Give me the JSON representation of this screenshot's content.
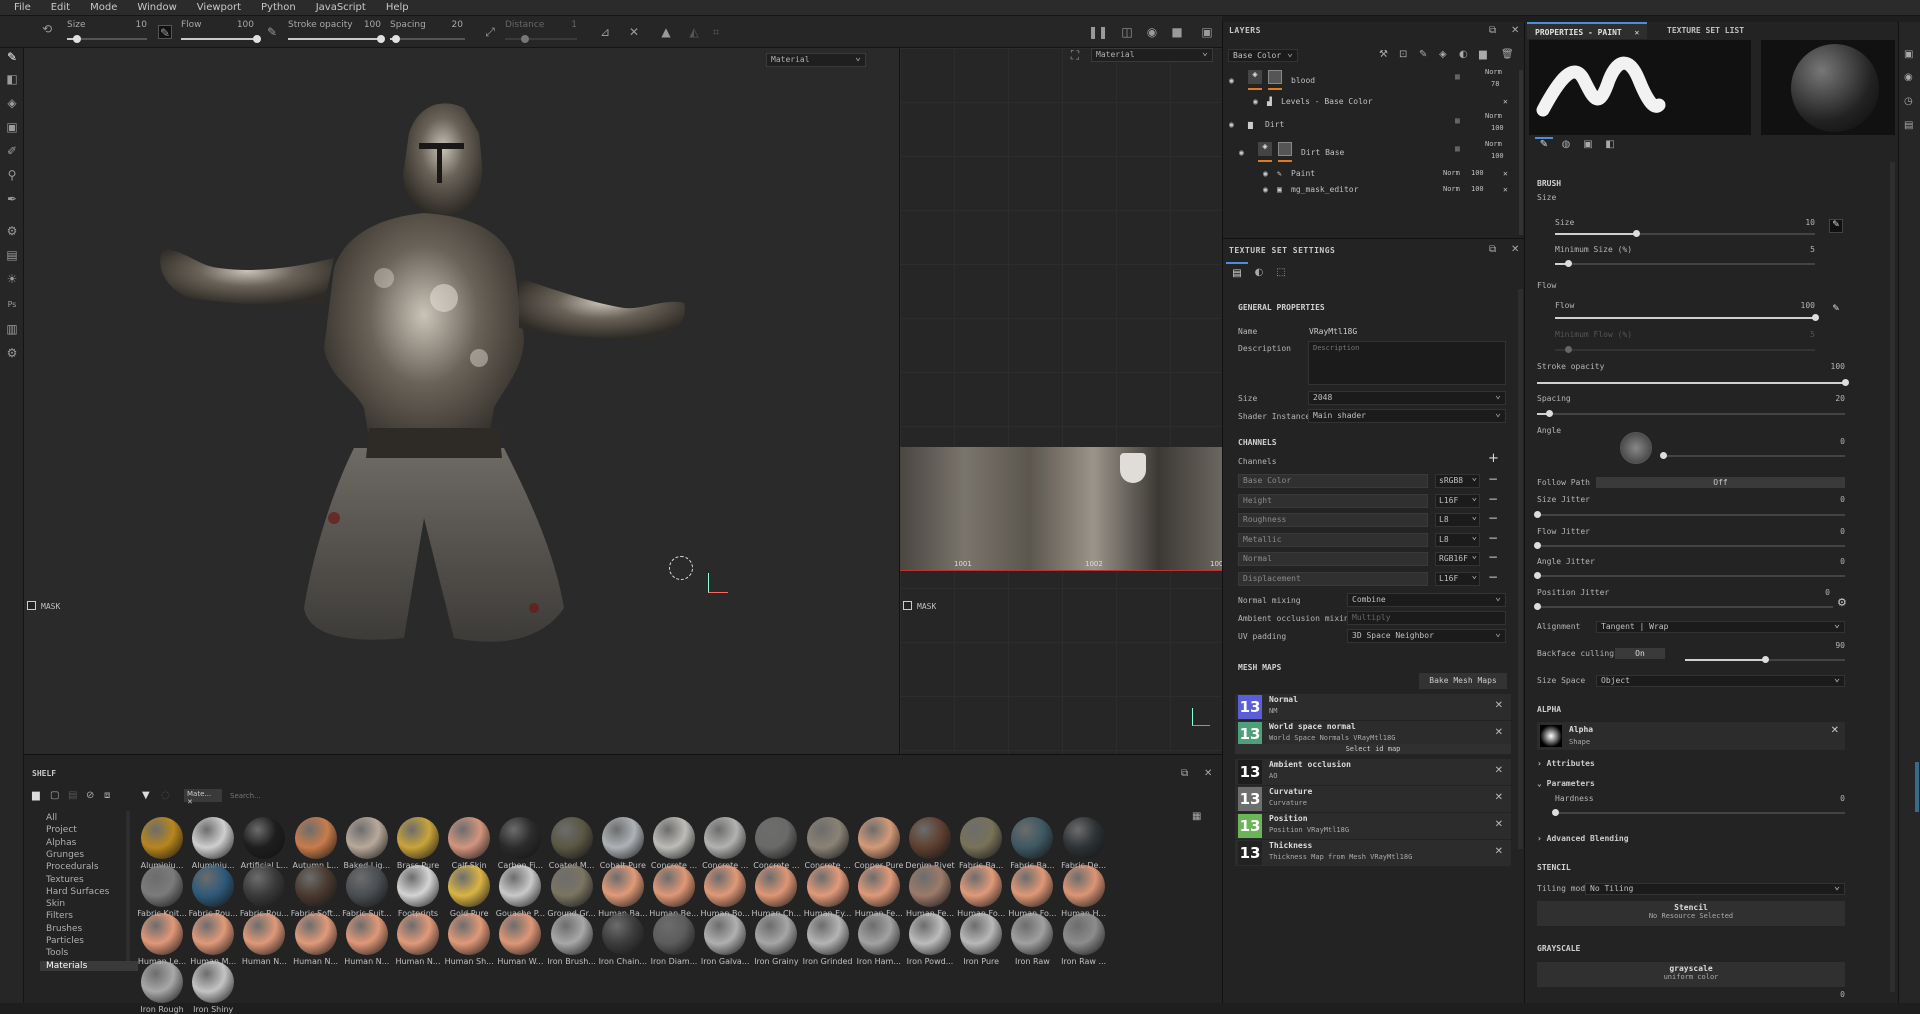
{
  "menu": [
    "File",
    "Edit",
    "Mode",
    "Window",
    "Viewport",
    "Python",
    "JavaScript",
    "Help"
  ],
  "toolbar": {
    "size_label": "Size",
    "size_value": "10",
    "flow_label": "Flow",
    "flow_value": "100",
    "stroke_label": "Stroke opacity",
    "stroke_value": "100",
    "spacing_label": "Spacing",
    "spacing_value": "20",
    "distance_label": "Distance",
    "distance_value": "1"
  },
  "viewport3d": {
    "mode": "Material",
    "mask_label": "MASK"
  },
  "viewport2d": {
    "mode": "Material",
    "mask_label": "MASK",
    "uv_tiles": [
      "1001",
      "1002",
      "100"
    ]
  },
  "layers": {
    "title": "LAYERS",
    "channel": "Base Color",
    "rows": [
      {
        "name": "blood",
        "blend": "Norm",
        "opacity": "78"
      },
      {
        "name": "Levels - Base Color"
      },
      {
        "name": "Dirt",
        "blend": "Norm",
        "opacity": "100"
      },
      {
        "name": "Dirt Base",
        "blend": "Norm",
        "opacity": "100"
      },
      {
        "name": "Paint",
        "blend": "Norm",
        "opacity": "100"
      },
      {
        "name": "mg_mask_editor",
        "blend": "Norm",
        "opacity": "100"
      }
    ]
  },
  "texset": {
    "title": "TEXTURE SET SETTINGS",
    "general": "GENERAL PROPERTIES",
    "name_label": "Name",
    "name_value": "VRayMtl18G",
    "desc_label": "Description",
    "desc_placeholder": "Description",
    "size_label": "Size",
    "size_value": "2048",
    "shader_label": "Shader Instance",
    "shader_value": "Main shader",
    "channels_title": "CHANNELS",
    "channels_label": "Channels",
    "channels": [
      {
        "name": "Base Color",
        "fmt": "sRGB8"
      },
      {
        "name": "Height",
        "fmt": "L16F"
      },
      {
        "name": "Roughness",
        "fmt": "L8"
      },
      {
        "name": "Metallic",
        "fmt": "L8"
      },
      {
        "name": "Normal",
        "fmt": "RGB16F"
      },
      {
        "name": "Displacement",
        "fmt": "L16F"
      }
    ],
    "normal_mixing_label": "Normal mixing",
    "normal_mixing_value": "Combine",
    "ao_mixing_label": "Ambient occlusion mixing",
    "ao_mixing_value": "Multiply",
    "uv_padding_label": "UV padding",
    "uv_padding_value": "3D Space Neighbor",
    "mesh_maps_title": "MESH MAPS",
    "bake_button": "Bake Mesh Maps",
    "select_id": "Select id map",
    "mesh_maps": [
      {
        "title": "Normal",
        "sub": "NM",
        "glyph": "13",
        "color": "#5a5fd8"
      },
      {
        "title": "World space normal",
        "sub": "World Space Normals VRayMtl18G",
        "glyph": "13",
        "color": "#4fa07a"
      },
      {
        "title": "Ambient occlusion",
        "sub": "AO",
        "glyph": "13",
        "color": "#1d1d1d"
      },
      {
        "title": "Curvature",
        "sub": "Curvature",
        "glyph": "13",
        "color": "#6e6e6e"
      },
      {
        "title": "Position",
        "sub": "Position VRayMtl18G",
        "glyph": "13",
        "color": "#6db35a"
      },
      {
        "title": "Thickness",
        "sub": "Thickness Map from Mesh VRayMtl18G",
        "glyph": "13",
        "color": "#222"
      }
    ]
  },
  "props": {
    "tab1": "PROPERTIES - PAINT",
    "tab2": "TEXTURE SET LIST",
    "brush": "BRUSH",
    "size_group": "Size",
    "size_label": "Size",
    "size_value": "10",
    "minsize_label": "Minimum Size (%)",
    "minsize_value": "5",
    "flow_group": "Flow",
    "flow_label": "Flow",
    "flow_value": "100",
    "minflow_label": "Minimum Flow (%)",
    "minflow_value": "5",
    "stroke_label": "Stroke opacity",
    "stroke_value": "100",
    "spacing_label": "Spacing",
    "spacing_value": "20",
    "angle_label": "Angle",
    "angle_value": "0",
    "follow_label": "Follow Path",
    "follow_value": "Off",
    "sizej_label": "Size Jitter",
    "sizej_value": "0",
    "flowj_label": "Flow Jitter",
    "flowj_value": "0",
    "anglej_label": "Angle Jitter",
    "anglej_value": "0",
    "posj_label": "Position Jitter",
    "posj_value": "0",
    "align_label": "Alignment",
    "align_value": "Tangent | Wrap",
    "backface_label": "Backface culling",
    "backface_on": "On",
    "backface_value": "90",
    "sizespace_label": "Size Space",
    "sizespace_value": "Object",
    "alpha_sec": "ALPHA",
    "alpha_name": "Alpha",
    "alpha_sub": "Shape",
    "attributes": "Attributes",
    "parameters": "Parameters",
    "hardness_label": "Hardness",
    "hardness_value": "0",
    "advanced": "Advanced Blending",
    "stencil_sec": "STENCIL",
    "tiling_label": "Tiling mode",
    "tiling_value": "No Tiling",
    "stencil_name": "Stencil",
    "stencil_sub": "No Resource Selected",
    "grayscale_sec": "GRAYSCALE",
    "gray_name": "grayscale",
    "gray_sub": "uniform color",
    "gray_value": "0"
  },
  "shelf": {
    "title": "SHELF",
    "filter_tag": "Mate...",
    "search_placeholder": "Search...",
    "categories": [
      "All",
      "Project",
      "Alphas",
      "Grunges",
      "Procedurals",
      "Textures",
      "Hard Surfaces",
      "Skin",
      "Filters",
      "Brushes",
      "Particles",
      "Tools",
      "Materials"
    ],
    "materials": [
      {
        "name": "Aluminiu...",
        "c": "#b8861c"
      },
      {
        "name": "Aluminiu...",
        "c": "#cfcfcf"
      },
      {
        "name": "Artificial L...",
        "c": "#1e1e1e"
      },
      {
        "name": "Autumn L...",
        "c": "#c87c4a"
      },
      {
        "name": "Baked Lig...",
        "c": "#b8a99a"
      },
      {
        "name": "Brass Pure",
        "c": "#c9a43a"
      },
      {
        "name": "Calf Skin",
        "c": "#d2957e"
      },
      {
        "name": "Carbon Fi...",
        "c": "#2c2c2c"
      },
      {
        "name": "Coated M...",
        "c": "#5a5744"
      },
      {
        "name": "Cobalt Pure",
        "c": "#aeb2b6"
      },
      {
        "name": "Concrete ...",
        "c": "#bdbcb8"
      },
      {
        "name": "Concrete ...",
        "c": "#b2b2b0"
      },
      {
        "name": "Concrete ...",
        "c": "#6a6a68"
      },
      {
        "name": "Concrete ...",
        "c": "#8a8275"
      },
      {
        "name": "Copper Pure",
        "c": "#d39a78"
      },
      {
        "name": "Denim Rivet",
        "c": "#5e4030"
      },
      {
        "name": "Fabric Ba...",
        "c": "#787258"
      },
      {
        "name": "Fabric Ba...",
        "c": "#3e5862"
      },
      {
        "name": "Fabric De...",
        "c": "#2e3336"
      },
      {
        "name": "Fabric Knit...",
        "c": "#7b7b7b"
      },
      {
        "name": "Fabric Rou...",
        "c": "#2f5a7a"
      },
      {
        "name": "Fabric Rou...",
        "c": "#3a3a3a"
      },
      {
        "name": "Fabric Soft...",
        "c": "#4a3a30"
      },
      {
        "name": "Fabric Suit...",
        "c": "#4a4e52"
      },
      {
        "name": "Footprints",
        "c": "#d4d4d4"
      },
      {
        "name": "Gold Pure",
        "c": "#d9b444"
      },
      {
        "name": "Gouache P...",
        "c": "#c9c9c9"
      },
      {
        "name": "Ground Gr...",
        "c": "#7a7462"
      },
      {
        "name": "Human Ba...",
        "c": "#e09a78"
      },
      {
        "name": "Human Be...",
        "c": "#df9876"
      },
      {
        "name": "Human Bo...",
        "c": "#e09878"
      },
      {
        "name": "Human Ch...",
        "c": "#de9676"
      },
      {
        "name": "Human Ey...",
        "c": "#e19a7a"
      },
      {
        "name": "Human Fe...",
        "c": "#df9978"
      },
      {
        "name": "Human Fe...",
        "c": "#9c7a6a"
      },
      {
        "name": "Human Fo...",
        "c": "#e09a7a"
      },
      {
        "name": "Human Fo...",
        "c": "#df9877"
      },
      {
        "name": "Human H...",
        "c": "#dc9575"
      },
      {
        "name": "Human Le...",
        "c": "#e09878"
      },
      {
        "name": "Human M...",
        "c": "#e09a7a"
      },
      {
        "name": "Human N...",
        "c": "#df9979"
      },
      {
        "name": "Human N...",
        "c": "#e09a7a"
      },
      {
        "name": "Human N...",
        "c": "#df9878"
      },
      {
        "name": "Human N...",
        "c": "#e09a7a"
      },
      {
        "name": "Human Sh...",
        "c": "#e09979"
      },
      {
        "name": "Human W...",
        "c": "#de9777"
      },
      {
        "name": "Iron Brush...",
        "c": "#a8a8a8"
      },
      {
        "name": "Iron Chain...",
        "c": "#3c3c3c"
      },
      {
        "name": "Iron Diam...",
        "c": "#5c5c5c"
      },
      {
        "name": "Iron Galva...",
        "c": "#b0b0b0"
      },
      {
        "name": "Iron Grainy",
        "c": "#a6a6a6"
      },
      {
        "name": "Iron Grinded",
        "c": "#b4b4b4"
      },
      {
        "name": "Iron Ham...",
        "c": "#a2a2a2"
      },
      {
        "name": "Iron Powd...",
        "c": "#bcbcbc"
      },
      {
        "name": "Iron Pure",
        "c": "#b8b8b8"
      },
      {
        "name": "Iron Raw",
        "c": "#a0a0a0"
      },
      {
        "name": "Iron Raw ...",
        "c": "#8c8c8c"
      },
      {
        "name": "Iron Rough",
        "c": "#a8a8a8"
      },
      {
        "name": "Iron Shiny",
        "c": "#c4c4c4"
      }
    ]
  }
}
